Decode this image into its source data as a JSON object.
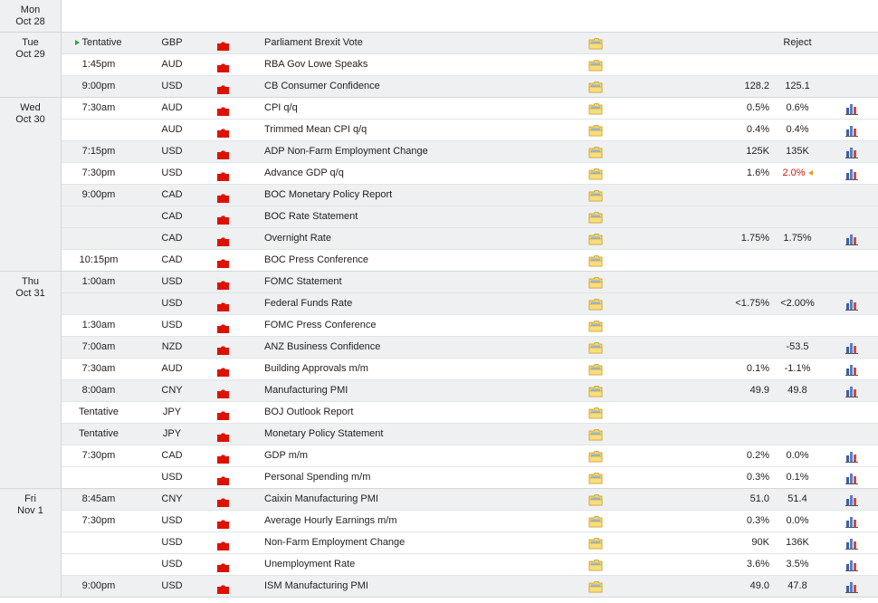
{
  "colors": {
    "impact_high": "#dd1100",
    "revised": "#cc1a10",
    "row_alt": "#eef0f2"
  },
  "days": [
    {
      "dow": "Mon",
      "date": "Oct 28",
      "rows": []
    },
    {
      "dow": "Tue",
      "date": "Oct 29",
      "rows": [
        {
          "time": "Tentative",
          "tentative_marker": true,
          "currency": "GBP",
          "impact": "high",
          "event": "Parliament Brexit Vote",
          "forecast": "",
          "previous": "Reject",
          "graph": false
        },
        {
          "time": "1:45pm",
          "currency": "AUD",
          "impact": "high",
          "event": "RBA Gov Lowe Speaks",
          "forecast": "",
          "previous": "",
          "graph": false
        },
        {
          "time": "9:00pm",
          "currency": "USD",
          "impact": "high",
          "event": "CB Consumer Confidence",
          "forecast": "128.2",
          "previous": "125.1",
          "graph": false
        }
      ]
    },
    {
      "dow": "Wed",
      "date": "Oct 30",
      "rows": [
        {
          "time": "7:30am",
          "currency": "AUD",
          "impact": "high",
          "event": "CPI q/q",
          "forecast": "0.5%",
          "previous": "0.6%",
          "graph": true
        },
        {
          "time": "",
          "currency": "AUD",
          "impact": "high",
          "event": "Trimmed Mean CPI q/q",
          "forecast": "0.4%",
          "previous": "0.4%",
          "graph": true,
          "join": true
        },
        {
          "time": "7:15pm",
          "currency": "USD",
          "impact": "high",
          "event": "ADP Non-Farm Employment Change",
          "forecast": "125K",
          "previous": "135K",
          "graph": true
        },
        {
          "time": "7:30pm",
          "currency": "USD",
          "impact": "high",
          "event": "Advance GDP q/q",
          "forecast": "1.6%",
          "previous": "2.0%",
          "previous_revised": true,
          "graph": true
        },
        {
          "time": "9:00pm",
          "currency": "CAD",
          "impact": "high",
          "event": "BOC Monetary Policy Report",
          "forecast": "",
          "previous": "",
          "graph": false
        },
        {
          "time": "",
          "currency": "CAD",
          "impact": "high",
          "event": "BOC Rate Statement",
          "forecast": "",
          "previous": "",
          "graph": false,
          "join": true
        },
        {
          "time": "",
          "currency": "CAD",
          "impact": "high",
          "event": "Overnight Rate",
          "forecast": "1.75%",
          "previous": "1.75%",
          "graph": true,
          "join": true
        },
        {
          "time": "10:15pm",
          "currency": "CAD",
          "impact": "high",
          "event": "BOC Press Conference",
          "forecast": "",
          "previous": "",
          "graph": false
        }
      ]
    },
    {
      "dow": "Thu",
      "date": "Oct 31",
      "rows": [
        {
          "time": "1:00am",
          "currency": "USD",
          "impact": "high",
          "event": "FOMC Statement",
          "forecast": "",
          "previous": "",
          "graph": false
        },
        {
          "time": "",
          "currency": "USD",
          "impact": "high",
          "event": "Federal Funds Rate",
          "forecast": "<1.75%",
          "previous": "<2.00%",
          "graph": true,
          "join": true
        },
        {
          "time": "1:30am",
          "currency": "USD",
          "impact": "high",
          "event": "FOMC Press Conference",
          "forecast": "",
          "previous": "",
          "graph": false
        },
        {
          "time": "7:00am",
          "currency": "NZD",
          "impact": "high",
          "event": "ANZ Business Confidence",
          "forecast": "",
          "previous": "-53.5",
          "graph": true
        },
        {
          "time": "7:30am",
          "currency": "AUD",
          "impact": "high",
          "event": "Building Approvals m/m",
          "forecast": "0.1%",
          "previous": "-1.1%",
          "graph": true
        },
        {
          "time": "8:00am",
          "currency": "CNY",
          "impact": "high",
          "event": "Manufacturing PMI",
          "forecast": "49.9",
          "previous": "49.8",
          "graph": true
        },
        {
          "time": "Tentative",
          "currency": "JPY",
          "impact": "high",
          "event": "BOJ Outlook Report",
          "forecast": "",
          "previous": "",
          "graph": false
        },
        {
          "time": "Tentative",
          "currency": "JPY",
          "impact": "high",
          "event": "Monetary Policy Statement",
          "forecast": "",
          "previous": "",
          "graph": false
        },
        {
          "time": "7:30pm",
          "currency": "CAD",
          "impact": "high",
          "event": "GDP m/m",
          "forecast": "0.2%",
          "previous": "0.0%",
          "graph": true
        },
        {
          "time": "",
          "currency": "USD",
          "impact": "high",
          "event": "Personal Spending m/m",
          "forecast": "0.3%",
          "previous": "0.1%",
          "graph": true,
          "join": true
        }
      ]
    },
    {
      "dow": "Fri",
      "date": "Nov 1",
      "rows": [
        {
          "time": "8:45am",
          "currency": "CNY",
          "impact": "high",
          "event": "Caixin Manufacturing PMI",
          "forecast": "51.0",
          "previous": "51.4",
          "graph": true
        },
        {
          "time": "7:30pm",
          "currency": "USD",
          "impact": "high",
          "event": "Average Hourly Earnings m/m",
          "forecast": "0.3%",
          "previous": "0.0%",
          "graph": true
        },
        {
          "time": "",
          "currency": "USD",
          "impact": "high",
          "event": "Non-Farm Employment Change",
          "forecast": "90K",
          "previous": "136K",
          "graph": true,
          "join": true
        },
        {
          "time": "",
          "currency": "USD",
          "impact": "high",
          "event": "Unemployment Rate",
          "forecast": "3.6%",
          "previous": "3.5%",
          "graph": true,
          "join": true
        },
        {
          "time": "9:00pm",
          "currency": "USD",
          "impact": "high",
          "event": "ISM Manufacturing PMI",
          "forecast": "49.0",
          "previous": "47.8",
          "graph": true
        }
      ]
    }
  ]
}
